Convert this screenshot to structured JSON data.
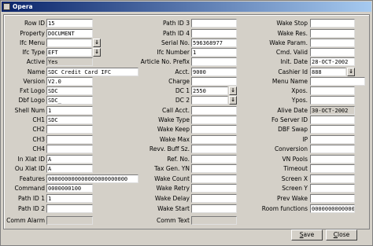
{
  "window": {
    "title": "Opera"
  },
  "lov_glyph": "↓",
  "fields": {
    "row_id": {
      "label": "Row ID",
      "value": "15"
    },
    "property": {
      "label": "Property",
      "value": "DOCUMENT"
    },
    "ifc_menu": {
      "label": "Ifc Menu",
      "value": ""
    },
    "ifc_type": {
      "label": "Ifc Type",
      "value": "EFT"
    },
    "active": {
      "label": "Active",
      "value": "Yes"
    },
    "name": {
      "label": "Name",
      "value": "SDC Credit Card IFC"
    },
    "version": {
      "label": "Version",
      "value": "V2.0"
    },
    "fxt_logo": {
      "label": "Fxt Logo",
      "value": "SDC"
    },
    "dbf_logo": {
      "label": "Dbf Logo",
      "value": "SDC_"
    },
    "shell_num": {
      "label": "Shell Num",
      "value": "1"
    },
    "ch1": {
      "label": "CH1",
      "value": "SDC"
    },
    "ch2": {
      "label": "CH2",
      "value": ""
    },
    "ch3": {
      "label": "CH3",
      "value": ""
    },
    "ch4": {
      "label": "CH4",
      "value": ""
    },
    "in_xlat_id": {
      "label": "In Xlat ID",
      "value": "A"
    },
    "ou_xlat_id": {
      "label": "Ou Xlat ID",
      "value": "A"
    },
    "features": {
      "label": "Features",
      "value": "000000000000000000000000"
    },
    "command": {
      "label": "Command",
      "value": "0000000100"
    },
    "path_id_1": {
      "label": "Path ID 1",
      "value": "1"
    },
    "path_id_2": {
      "label": "Path ID 2",
      "value": ""
    },
    "comm_alarm": {
      "label": "Comm Alarm",
      "value": ""
    },
    "path_id_3": {
      "label": "Path ID 3",
      "value": ""
    },
    "path_id_4": {
      "label": "Path ID 4",
      "value": ""
    },
    "serial_no": {
      "label": "Serial No.",
      "value": "596368977"
    },
    "ifc_number": {
      "label": "Ifc Number",
      "value": "1"
    },
    "article_prefix": {
      "label": "Article No. Prefix",
      "value": ""
    },
    "acct": {
      "label": "Acct.",
      "value": "9000"
    },
    "charge": {
      "label": "Charge",
      "value": ""
    },
    "dc1": {
      "label": "DC 1",
      "value": "2550"
    },
    "dc2": {
      "label": "DC 2",
      "value": ""
    },
    "call_acct": {
      "label": "Call Acct.",
      "value": ""
    },
    "wake_type": {
      "label": "Wake Type",
      "value": ""
    },
    "wake_keep": {
      "label": "Wake Keep",
      "value": ""
    },
    "wake_max": {
      "label": "Wake Max",
      "value": ""
    },
    "revv_buff_sz": {
      "label": "Revv. Buff Sz.",
      "value": ""
    },
    "ref_no": {
      "label": "Ref. No.",
      "value": ""
    },
    "tax_gen_yn": {
      "label": "Tax Gen. YN",
      "value": ""
    },
    "wake_count": {
      "label": "Wake Count",
      "value": ""
    },
    "wake_retry": {
      "label": "Wake Retry",
      "value": ""
    },
    "wake_delay": {
      "label": "Wake Delay",
      "value": ""
    },
    "wake_start": {
      "label": "Wake Start",
      "value": ""
    },
    "comm_text": {
      "label": "Comm Text",
      "value": ""
    },
    "wake_stop": {
      "label": "Wake Stop",
      "value": ""
    },
    "wake_res": {
      "label": "Wake Res.",
      "value": ""
    },
    "wake_param": {
      "label": "Wake Param.",
      "value": ""
    },
    "cmd_valid": {
      "label": "Cmd. Valid",
      "value": ""
    },
    "init_date": {
      "label": "Init. Date",
      "value": "28-OCT-2002"
    },
    "cashier_id": {
      "label": "Cashier Id",
      "value": "888"
    },
    "menu_name": {
      "label": "Menu Name",
      "value": ""
    },
    "xpos": {
      "label": "Xpos.",
      "value": ""
    },
    "ypos": {
      "label": "Ypos.",
      "value": ""
    },
    "alive_date": {
      "label": "Alive Date",
      "value": "30-OCT-2002"
    },
    "fo_server_id": {
      "label": "Fo Server ID",
      "value": ""
    },
    "dbf_swap": {
      "label": "DBF Swap",
      "value": ""
    },
    "ip": {
      "label": "IP",
      "value": ""
    },
    "conversion": {
      "label": "Conversion",
      "value": ""
    },
    "vn_pools": {
      "label": "VN Pools",
      "value": ""
    },
    "timeout": {
      "label": "Timeout",
      "value": ""
    },
    "screen_x": {
      "label": "Screen X",
      "value": ""
    },
    "screen_y": {
      "label": "Screen Y",
      "value": ""
    },
    "prev_wake": {
      "label": "Prev Wake",
      "value": ""
    },
    "room_functions": {
      "label": "Room functions",
      "value": "00000000000000"
    }
  },
  "buttons": {
    "save": {
      "label_mnemonic": "S",
      "label_rest": "ave"
    },
    "close": {
      "label_mnemonic": "C",
      "label_rest": "lose"
    }
  }
}
